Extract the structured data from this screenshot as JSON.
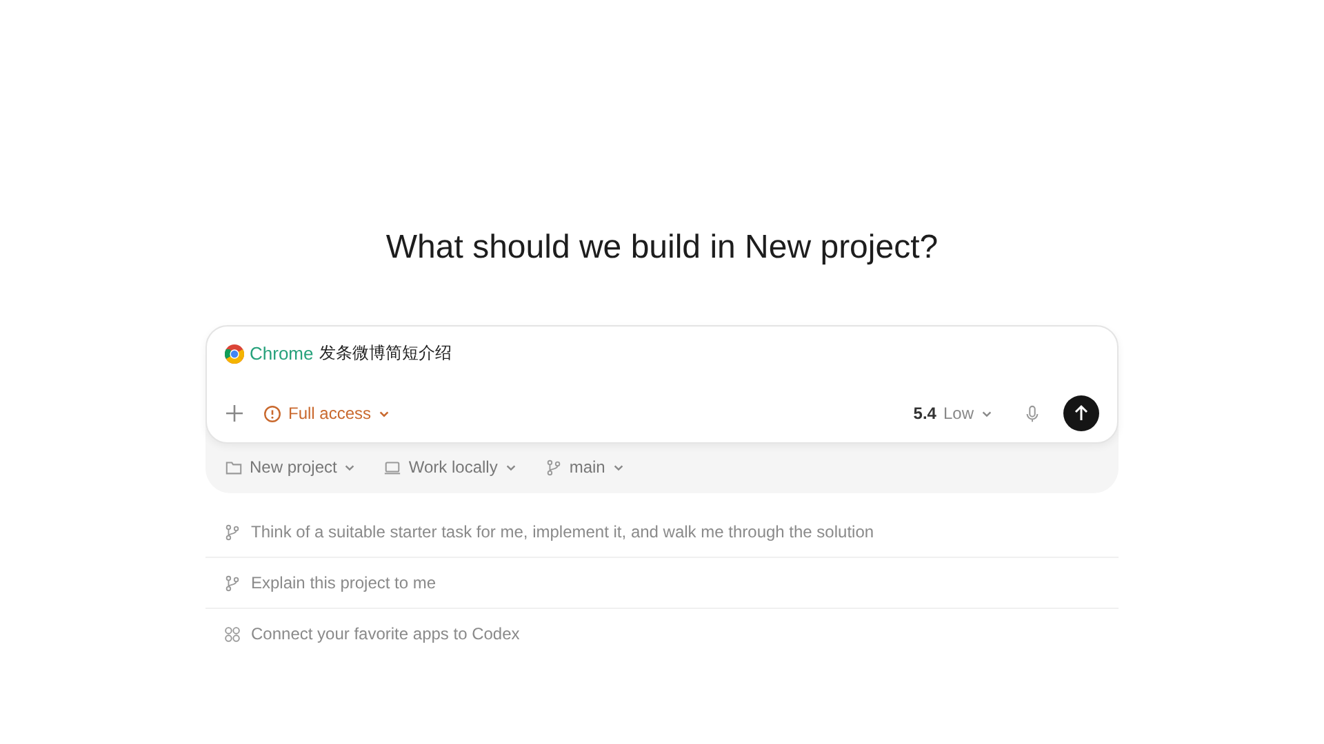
{
  "heading": "What should we build in New project?",
  "composer": {
    "app": "Chrome",
    "value": "发条微博简短介绍",
    "access": "Full access",
    "model": "5.4",
    "effort": "Low"
  },
  "context_bar": [
    {
      "kind": "folder",
      "label": "New project"
    },
    {
      "kind": "laptop",
      "label": "Work locally"
    },
    {
      "kind": "branch",
      "label": "main"
    }
  ],
  "suggestions": [
    {
      "kind": "branch",
      "text": "Think of a suitable starter task for me, implement it, and walk me through the solution"
    },
    {
      "kind": "branch",
      "text": "Explain this project to me"
    },
    {
      "kind": "apps",
      "text": "Connect your favorite apps to Codex"
    }
  ]
}
